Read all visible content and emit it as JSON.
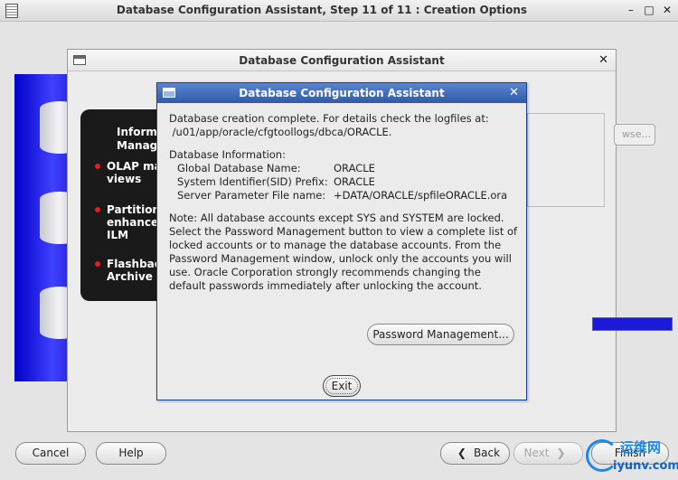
{
  "window": {
    "title": "Database Configuration Assistant, Step 11 of 11 : Creation Options",
    "minimize": "–",
    "maximize": "□",
    "close": "✕"
  },
  "background_dialog": {
    "title": "Database Configuration Assistant",
    "close": "✕",
    "panel_heading_1": "Informa",
    "panel_heading_2": "Manage",
    "panel_items": [
      {
        "line1": "OLAP ma",
        "line2": "views"
      },
      {
        "line1": "Partitioni",
        "line2": "enhancer",
        "line3": "ILM"
      },
      {
        "line1": "Flashbacl",
        "line2": "Archive"
      }
    ],
    "browse_label": "wse..."
  },
  "dialog": {
    "title": "Database Configuration Assistant",
    "close": "✕",
    "complete_line1": "Database creation complete. For details check the logfiles at:",
    "complete_line2": " /u01/app/oracle/cfgtoollogs/dbca/ORACLE.",
    "info_heading": "Database Information:",
    "info": [
      {
        "key": "Global Database Name:",
        "value": "ORACLE"
      },
      {
        "key": "System Identifier(SID) Prefix:",
        "value": "ORACLE"
      },
      {
        "key": "Server Parameter File name:",
        "value": "+DATA/ORACLE/spfileORACLE.ora"
      }
    ],
    "note_lines": [
      "Note: All database accounts except SYS and SYSTEM are locked.",
      "Select the Password Management button to view a complete list of",
      "locked accounts or to manage the database accounts. From the",
      "Password Management window, unlock only the accounts you will",
      "use. Oracle Corporation strongly recommends changing the",
      "default passwords immediately after unlocking the account."
    ],
    "password_button": "Password Management...",
    "exit_button": "Exit"
  },
  "footer": {
    "cancel": "Cancel",
    "help": "Help",
    "back": "Back",
    "next": "Next",
    "finish": "Finish",
    "back_arrow": "❮",
    "next_arrow": "❯"
  },
  "watermark": {
    "cn": "运维网",
    "url": "iyunv.com"
  }
}
